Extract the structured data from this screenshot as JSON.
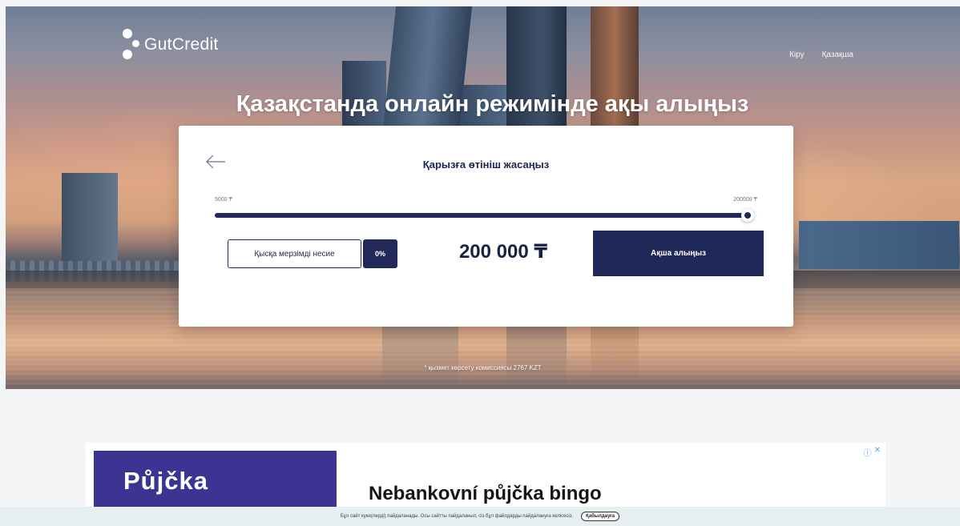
{
  "brand": {
    "name": "GutCredit"
  },
  "nav": {
    "login": "Кіру",
    "language": "Қазақша"
  },
  "hero": {
    "title": "Қазақстанда онлайн режимінде ақы алыңыз",
    "commission_note": "* қызмет көрсету комиссиясы 2767 KZT"
  },
  "form": {
    "title": "Қарызға өтініш жасаңыз",
    "range_min": "5000 ₸",
    "range_max": "200000 ₸",
    "slider_value_fraction": 1.0,
    "loan_type_label": "Қысқа мерзімді несие",
    "rate": "0%",
    "amount": "200 000 ₸",
    "submit_label": "Ақша алыңыз"
  },
  "ad": {
    "image_text": "Půjčka",
    "headline": "Nebankovní půjčka bingo",
    "info_icon": "info-icon",
    "close_icon": "close-icon"
  },
  "cookie": {
    "text": "Бұл сайт куки(лерді) пайдаланады. Осы сайтты пайдаланып, сіз бұл файлдарды пайдалануға келісесіз.",
    "accept_label": "Қабылдауға"
  },
  "colors": {
    "primary": "#22295a",
    "cookie_bg": "#e6eef2",
    "ad_purple": "#3d3392"
  }
}
